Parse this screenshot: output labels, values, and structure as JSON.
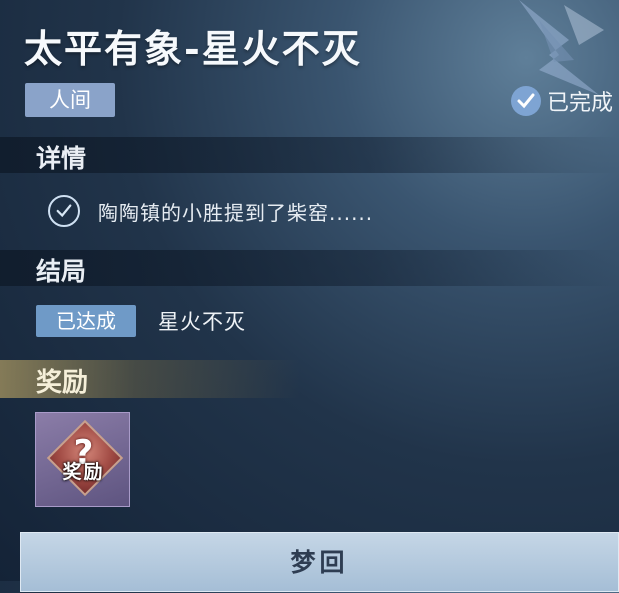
{
  "header": {
    "title": "太平有象-星火不灭",
    "realm_tag": "人间",
    "status_text": "已完成"
  },
  "details": {
    "section_title": "详情",
    "items": [
      {
        "text": "陶陶镇的小胜提到了柴窑......",
        "completed": true
      }
    ]
  },
  "ending": {
    "section_title": "结局",
    "badge": "已达成",
    "name": "星火不灭"
  },
  "reward": {
    "section_title": "奖励",
    "item_label": "奖励",
    "item_symbol": "?",
    "icon": "mystery-reward-icon"
  },
  "actions": {
    "dream_button": "梦回"
  },
  "colors": {
    "accent": "#7ea4d3",
    "tag": "#8aa3c9",
    "reward_gold": "#a89660"
  }
}
